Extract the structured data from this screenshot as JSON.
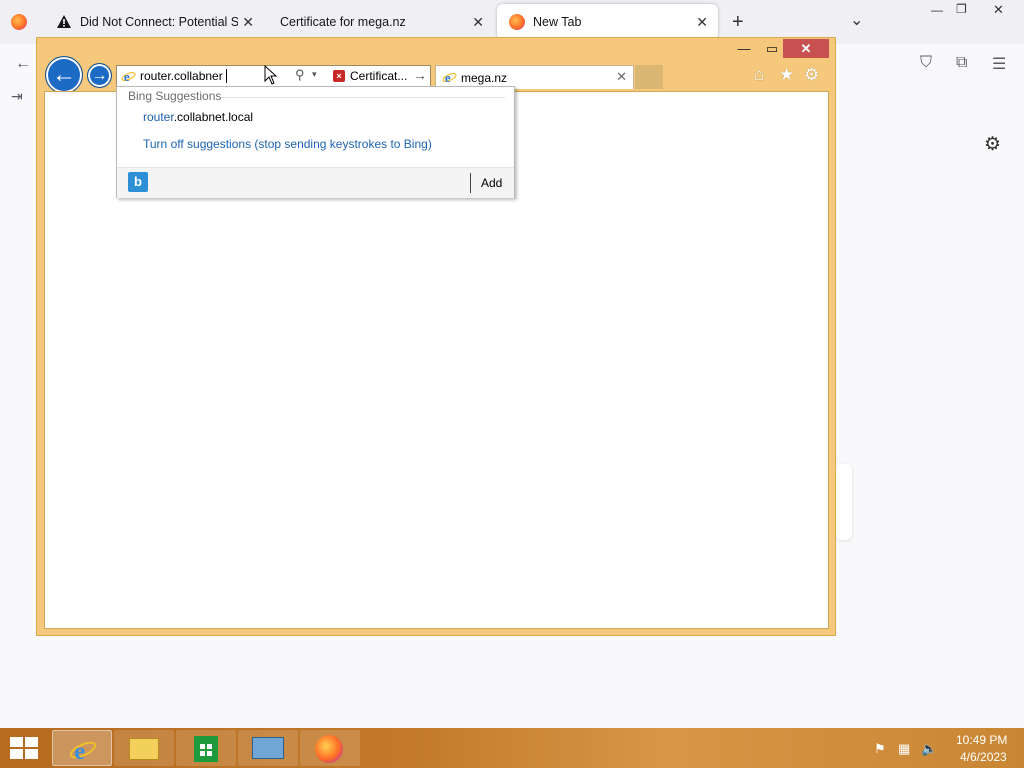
{
  "firefox": {
    "tabs": [
      {
        "title": "Did Not Connect: Potential Secu",
        "icon": "warning-icon"
      },
      {
        "title": "Certificate for mega.nz",
        "icon": "none"
      },
      {
        "title": "New Tab",
        "icon": "firefox-icon"
      }
    ],
    "new_tab_symbol": "+",
    "list_tabs_symbol": "⌄",
    "close_symbol": "✕",
    "window_controls": {
      "minimize": "—",
      "restore": "❐",
      "close": "✕"
    },
    "toolbar_icons": {
      "back": "←",
      "pocket": "⛉",
      "extensions": "⧉",
      "menu": "☰",
      "import": "⇥",
      "settings": "⚙"
    }
  },
  "ie": {
    "window_controls": {
      "minimize": "—",
      "maximize": "▭",
      "close": "✕"
    },
    "back_symbol": "←",
    "forward_symbol": "→",
    "address": {
      "value": "router.collabner",
      "search_symbol": "⚲",
      "dropdown_symbol": "▾",
      "cert_label": "Certificat...",
      "go_symbol": "→"
    },
    "tab": {
      "label": "mega.nz",
      "close_symbol": "✕"
    },
    "toolbar": {
      "home": "⌂",
      "favorites": "★",
      "tools": "⚙"
    },
    "suggestions": {
      "header": "Bing Suggestions",
      "item_highlight": "router",
      "item_rest": ".collabnet.local",
      "turn_off": "Turn off suggestions (stop sending keystrokes to Bing)",
      "add_label": "Add",
      "bing_logo": "b"
    }
  },
  "taskbar": {
    "apps": [
      "internet-explorer",
      "file-explorer",
      "store",
      "control-panel",
      "firefox"
    ],
    "tray": {
      "flag": "⚑",
      "network": "▦",
      "volume": "🔈"
    },
    "clock": {
      "time": "10:49 PM",
      "date": "4/6/2023"
    }
  },
  "colors": {
    "ie_frame": "#f5c87b",
    "ie_accent": "#1b6ac4",
    "taskbar": "#c27a2a",
    "link": "#1e64b4"
  }
}
